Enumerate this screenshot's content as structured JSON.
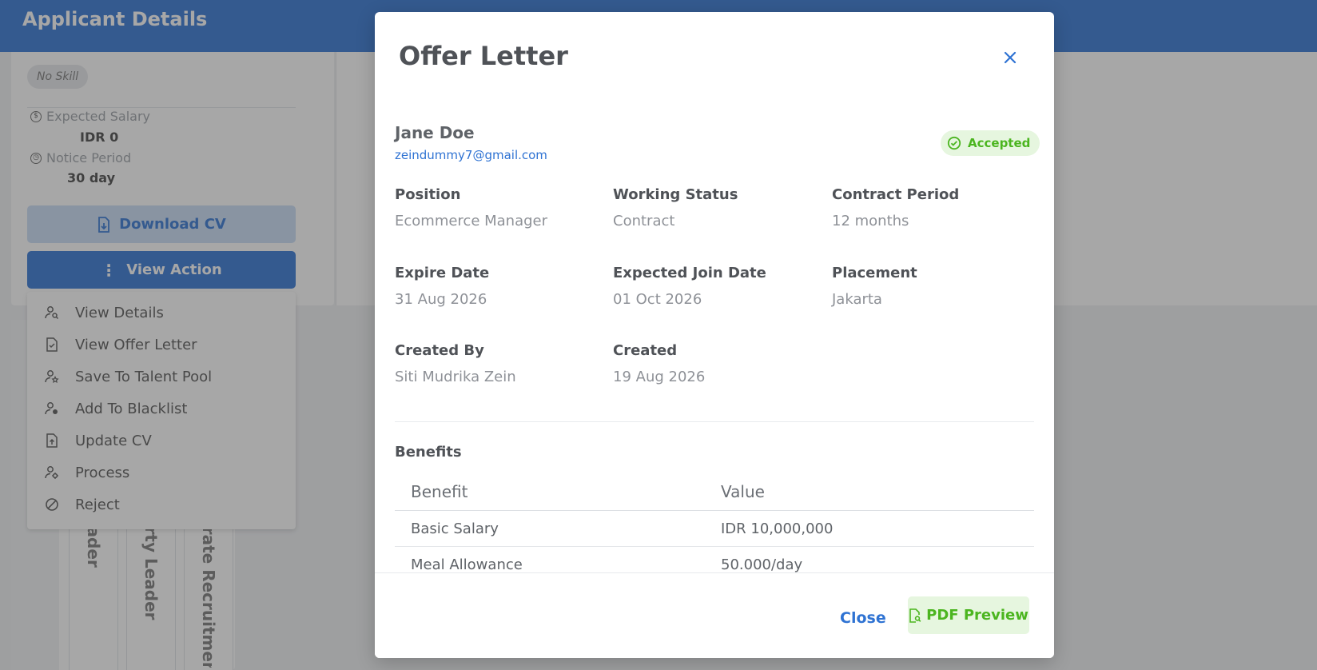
{
  "header": {
    "title": "Applicant Details"
  },
  "sidebar": {
    "skill_chip": "No Skill",
    "expected_salary_label": "Expected Salary",
    "expected_salary_value": "IDR 0",
    "notice_period_label": "Notice Period",
    "notice_period_value": "30 day",
    "download_cv_label": "Download CV",
    "view_action_label": "View Action"
  },
  "action_menu": {
    "items": [
      {
        "label": "View Details",
        "icon": "user-search-icon"
      },
      {
        "label": "View Offer Letter",
        "icon": "file-check-icon"
      },
      {
        "label": "Save To Talent Pool",
        "icon": "user-star-icon"
      },
      {
        "label": "Add To Blacklist",
        "icon": "user-block-icon"
      },
      {
        "label": "Update CV",
        "icon": "file-upload-icon"
      },
      {
        "label": "Process",
        "icon": "user-cog-icon"
      },
      {
        "label": "Reject",
        "icon": "ban-icon"
      }
    ]
  },
  "stages": [
    "eader",
    "erty Leader",
    "orate Recruitment"
  ],
  "modal": {
    "title": "Offer Letter",
    "candidate": {
      "name": "Jane Doe",
      "email": "zeindummy7@gmail.com"
    },
    "status": "Accepted",
    "fields": {
      "position": {
        "label": "Position",
        "value": "Ecommerce Manager"
      },
      "working_status": {
        "label": "Working Status",
        "value": "Contract"
      },
      "contract_period": {
        "label": "Contract Period",
        "value": "12 months"
      },
      "expire_date": {
        "label": "Expire Date",
        "value": "31 Aug 2026"
      },
      "expected_join_date": {
        "label": "Expected Join Date",
        "value": "01 Oct 2026"
      },
      "placement": {
        "label": "Placement",
        "value": "Jakarta"
      },
      "created_by": {
        "label": "Created By",
        "value": "Siti Mudrika Zein"
      },
      "created": {
        "label": "Created",
        "value": "19 Aug 2026"
      }
    },
    "benefits": {
      "title": "Benefits",
      "columns": [
        "Benefit",
        "Value"
      ],
      "rows": [
        [
          "Basic Salary",
          "IDR 10,000,000"
        ],
        [
          "Meal Allowance",
          "50.000/day"
        ]
      ]
    },
    "footer": {
      "close_label": "Close",
      "pdf_label": "PDF Preview"
    }
  },
  "colors": {
    "primary": "#2f73d3",
    "success": "#4bb51f",
    "success_bg": "#e6f6df"
  }
}
